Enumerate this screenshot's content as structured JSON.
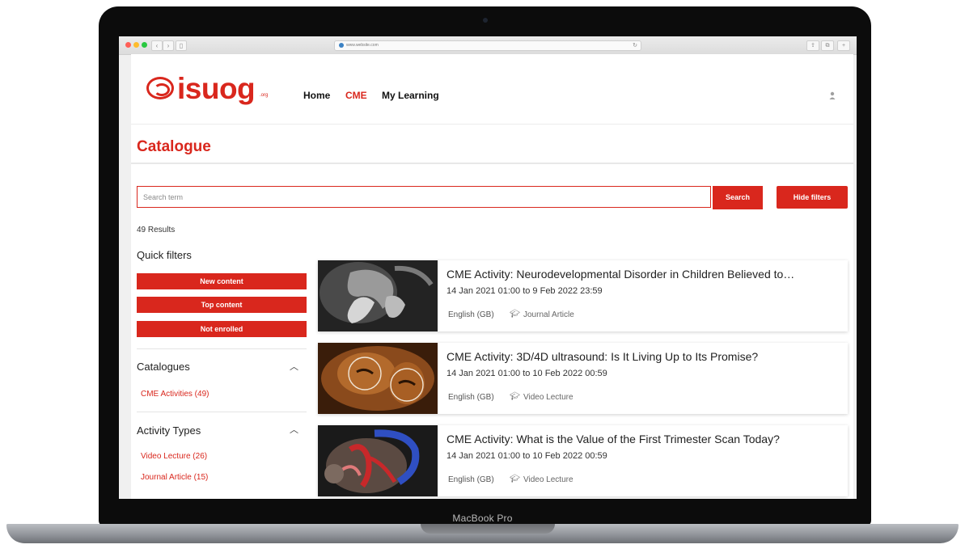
{
  "device": {
    "label": "MacBook Pro"
  },
  "browser": {
    "url": "www.website.com"
  },
  "header": {
    "logo_text": "isuog",
    "logo_suffix": ".org",
    "nav": [
      {
        "label": "Home",
        "active": false
      },
      {
        "label": "CME",
        "active": true
      },
      {
        "label": "My Learning",
        "active": false
      }
    ]
  },
  "page": {
    "title": "Catalogue"
  },
  "search": {
    "placeholder": "Search term",
    "button_label": "Search",
    "hide_filters_label": "Hide filters"
  },
  "results_count": "49 Results",
  "sidebar": {
    "quick_filters_title": "Quick filters",
    "quick_filters": [
      "New content",
      "Top content",
      "Not enrolled"
    ],
    "catalogues": {
      "title": "Catalogues",
      "items": [
        "CME Activities (49)"
      ]
    },
    "activity_types": {
      "title": "Activity Types",
      "items": [
        "Video Lecture (26)",
        "Journal Article (15)"
      ]
    }
  },
  "cards": [
    {
      "title": "CME Activity: Neurodevelopmental Disorder in Children Believed to…",
      "dates": "14 Jan 2021 01:00 to 9 Feb 2022 23:59",
      "language": "English (GB)",
      "type": "Journal Article"
    },
    {
      "title": "CME Activity: 3D/4D ultrasound: Is It Living Up to Its Promise?",
      "dates": "14 Jan 2021 01:00 to 10 Feb 2022 00:59",
      "language": "English (GB)",
      "type": "Video Lecture"
    },
    {
      "title": "CME Activity: What is the Value of the First Trimester Scan Today?",
      "dates": "14 Jan 2021 01:00 to 10 Feb 2022 00:59",
      "language": "English (GB)",
      "type": "Video Lecture"
    }
  ],
  "colors": {
    "accent": "#d9271d",
    "text": "#222222"
  }
}
